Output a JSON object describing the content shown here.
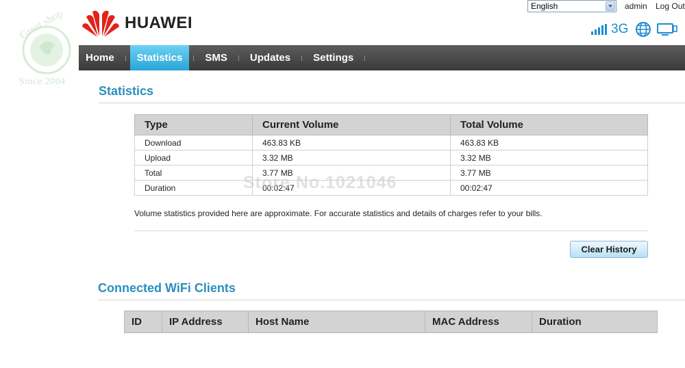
{
  "watermark": {
    "since": "Since 2004",
    "store_text": "Store No.1021046"
  },
  "brand": {
    "name": "HUAWEI",
    "logo_color": "#e2231a"
  },
  "top": {
    "language": "English",
    "user": "admin",
    "logout": "Log Out"
  },
  "status": {
    "network": "3G",
    "signal_icon": "signal-bars-icon",
    "globe_icon": "globe-icon",
    "device_icon": "monitor-icon",
    "color": "#1f8ccf"
  },
  "nav": {
    "items": [
      {
        "label": "Home",
        "active": false
      },
      {
        "label": "Statistics",
        "active": true
      },
      {
        "label": "SMS",
        "active": false
      },
      {
        "label": "Updates",
        "active": false
      },
      {
        "label": "Settings",
        "active": false
      }
    ],
    "active_color": "#27a5d8"
  },
  "statistics": {
    "title": "Statistics",
    "columns": [
      "Type",
      "Current Volume",
      "Total Volume"
    ],
    "rows": [
      [
        "Download",
        "463.83 KB",
        "463.83 KB"
      ],
      [
        "Upload",
        "3.32 MB",
        "3.32 MB"
      ],
      [
        "Total",
        "3.77 MB",
        "3.77 MB"
      ],
      [
        "Duration",
        "00:02:47",
        "00:02:47"
      ]
    ],
    "note": "Volume statistics provided here are approximate. For accurate statistics and details of charges refer to your bills.",
    "clear_button": "Clear History"
  },
  "wifi_clients": {
    "title": "Connected WiFi Clients",
    "columns": [
      "ID",
      "IP Address",
      "Host Name",
      "MAC Address",
      "Duration"
    ]
  }
}
